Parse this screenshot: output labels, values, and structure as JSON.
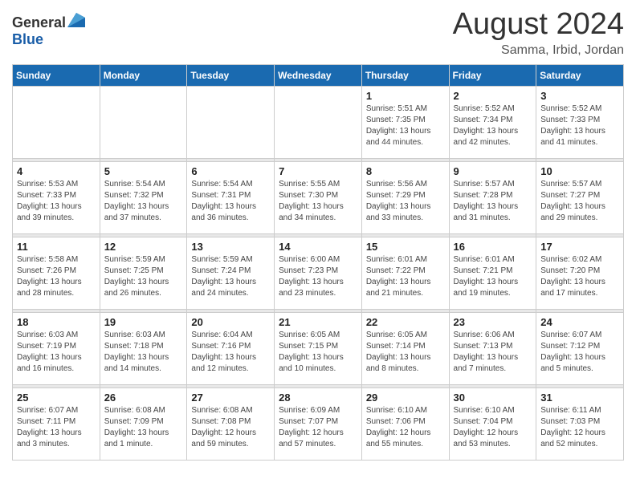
{
  "header": {
    "logo_general": "General",
    "logo_blue": "Blue",
    "month_year": "August 2024",
    "location": "Samma, Irbid, Jordan"
  },
  "weekdays": [
    "Sunday",
    "Monday",
    "Tuesday",
    "Wednesday",
    "Thursday",
    "Friday",
    "Saturday"
  ],
  "weeks": [
    [
      {
        "day": "",
        "info": ""
      },
      {
        "day": "",
        "info": ""
      },
      {
        "day": "",
        "info": ""
      },
      {
        "day": "",
        "info": ""
      },
      {
        "day": "1",
        "info": "Sunrise: 5:51 AM\nSunset: 7:35 PM\nDaylight: 13 hours\nand 44 minutes."
      },
      {
        "day": "2",
        "info": "Sunrise: 5:52 AM\nSunset: 7:34 PM\nDaylight: 13 hours\nand 42 minutes."
      },
      {
        "day": "3",
        "info": "Sunrise: 5:52 AM\nSunset: 7:33 PM\nDaylight: 13 hours\nand 41 minutes."
      }
    ],
    [
      {
        "day": "4",
        "info": "Sunrise: 5:53 AM\nSunset: 7:33 PM\nDaylight: 13 hours\nand 39 minutes."
      },
      {
        "day": "5",
        "info": "Sunrise: 5:54 AM\nSunset: 7:32 PM\nDaylight: 13 hours\nand 37 minutes."
      },
      {
        "day": "6",
        "info": "Sunrise: 5:54 AM\nSunset: 7:31 PM\nDaylight: 13 hours\nand 36 minutes."
      },
      {
        "day": "7",
        "info": "Sunrise: 5:55 AM\nSunset: 7:30 PM\nDaylight: 13 hours\nand 34 minutes."
      },
      {
        "day": "8",
        "info": "Sunrise: 5:56 AM\nSunset: 7:29 PM\nDaylight: 13 hours\nand 33 minutes."
      },
      {
        "day": "9",
        "info": "Sunrise: 5:57 AM\nSunset: 7:28 PM\nDaylight: 13 hours\nand 31 minutes."
      },
      {
        "day": "10",
        "info": "Sunrise: 5:57 AM\nSunset: 7:27 PM\nDaylight: 13 hours\nand 29 minutes."
      }
    ],
    [
      {
        "day": "11",
        "info": "Sunrise: 5:58 AM\nSunset: 7:26 PM\nDaylight: 13 hours\nand 28 minutes."
      },
      {
        "day": "12",
        "info": "Sunrise: 5:59 AM\nSunset: 7:25 PM\nDaylight: 13 hours\nand 26 minutes."
      },
      {
        "day": "13",
        "info": "Sunrise: 5:59 AM\nSunset: 7:24 PM\nDaylight: 13 hours\nand 24 minutes."
      },
      {
        "day": "14",
        "info": "Sunrise: 6:00 AM\nSunset: 7:23 PM\nDaylight: 13 hours\nand 23 minutes."
      },
      {
        "day": "15",
        "info": "Sunrise: 6:01 AM\nSunset: 7:22 PM\nDaylight: 13 hours\nand 21 minutes."
      },
      {
        "day": "16",
        "info": "Sunrise: 6:01 AM\nSunset: 7:21 PM\nDaylight: 13 hours\nand 19 minutes."
      },
      {
        "day": "17",
        "info": "Sunrise: 6:02 AM\nSunset: 7:20 PM\nDaylight: 13 hours\nand 17 minutes."
      }
    ],
    [
      {
        "day": "18",
        "info": "Sunrise: 6:03 AM\nSunset: 7:19 PM\nDaylight: 13 hours\nand 16 minutes."
      },
      {
        "day": "19",
        "info": "Sunrise: 6:03 AM\nSunset: 7:18 PM\nDaylight: 13 hours\nand 14 minutes."
      },
      {
        "day": "20",
        "info": "Sunrise: 6:04 AM\nSunset: 7:16 PM\nDaylight: 13 hours\nand 12 minutes."
      },
      {
        "day": "21",
        "info": "Sunrise: 6:05 AM\nSunset: 7:15 PM\nDaylight: 13 hours\nand 10 minutes."
      },
      {
        "day": "22",
        "info": "Sunrise: 6:05 AM\nSunset: 7:14 PM\nDaylight: 13 hours\nand 8 minutes."
      },
      {
        "day": "23",
        "info": "Sunrise: 6:06 AM\nSunset: 7:13 PM\nDaylight: 13 hours\nand 7 minutes."
      },
      {
        "day": "24",
        "info": "Sunrise: 6:07 AM\nSunset: 7:12 PM\nDaylight: 13 hours\nand 5 minutes."
      }
    ],
    [
      {
        "day": "25",
        "info": "Sunrise: 6:07 AM\nSunset: 7:11 PM\nDaylight: 13 hours\nand 3 minutes."
      },
      {
        "day": "26",
        "info": "Sunrise: 6:08 AM\nSunset: 7:09 PM\nDaylight: 13 hours\nand 1 minute."
      },
      {
        "day": "27",
        "info": "Sunrise: 6:08 AM\nSunset: 7:08 PM\nDaylight: 12 hours\nand 59 minutes."
      },
      {
        "day": "28",
        "info": "Sunrise: 6:09 AM\nSunset: 7:07 PM\nDaylight: 12 hours\nand 57 minutes."
      },
      {
        "day": "29",
        "info": "Sunrise: 6:10 AM\nSunset: 7:06 PM\nDaylight: 12 hours\nand 55 minutes."
      },
      {
        "day": "30",
        "info": "Sunrise: 6:10 AM\nSunset: 7:04 PM\nDaylight: 12 hours\nand 53 minutes."
      },
      {
        "day": "31",
        "info": "Sunrise: 6:11 AM\nSunset: 7:03 PM\nDaylight: 12 hours\nand 52 minutes."
      }
    ]
  ]
}
